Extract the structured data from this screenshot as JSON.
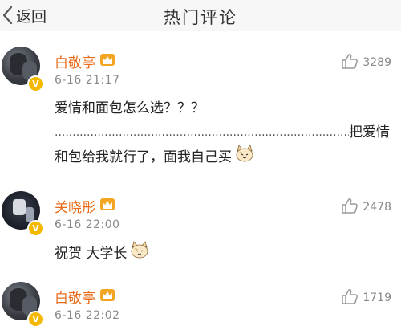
{
  "header": {
    "back_label": "返回",
    "title": "热门评论"
  },
  "comments": [
    {
      "user": "白敬亭",
      "time": "6-16 21:17",
      "likes": "3289",
      "line1": "爱情和面包怎么选？？？",
      "line2_dots": "..............................................................................................................",
      "line2_tail": "把爱情",
      "line3": "和包给我就行了，面我自己买"
    },
    {
      "user": "关晓彤",
      "time": "6-16 22:00",
      "likes": "2478",
      "line1": "祝贺 大学长"
    },
    {
      "user": "白敬亭",
      "time": "6-16 22:02",
      "likes": "1719"
    }
  ],
  "colors": {
    "username": "#e86c1a",
    "vbadge": "#f5b800",
    "meta": "#888888"
  },
  "icons": {
    "back": "chevron-left-icon",
    "like": "thumbs-up-icon",
    "crown": "vip-crown-icon",
    "emoji": "cat-face-emoji-icon",
    "verified": "verified-v-icon"
  }
}
